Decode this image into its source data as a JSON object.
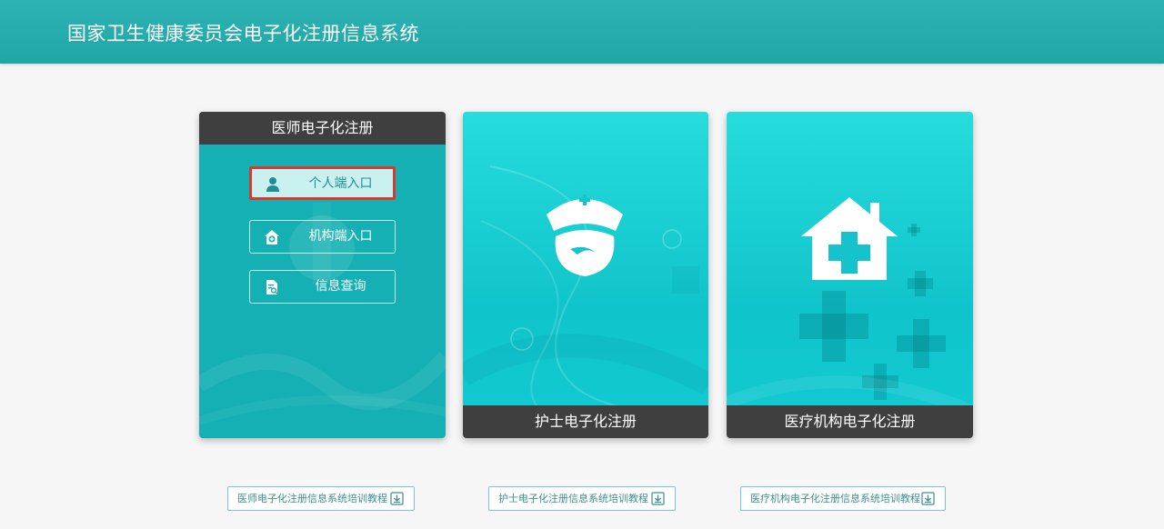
{
  "header": {
    "title": "国家卫生健康委员会电子化注册信息系统"
  },
  "cards": {
    "doctor": {
      "title": "医师电子化注册",
      "buttons": [
        {
          "label": "个人端入口",
          "icon": "person-icon",
          "selected": true
        },
        {
          "label": "机构端入口",
          "icon": "hospital-icon",
          "selected": false
        },
        {
          "label": "信息查询",
          "icon": "document-search-icon",
          "selected": false
        }
      ]
    },
    "nurse": {
      "title": "护士电子化注册",
      "icon": "nurse-cap-icon"
    },
    "institution": {
      "title": "医疗机构电子化注册",
      "icon": "hospital-house-icon"
    }
  },
  "tutorials": [
    {
      "label": "医师电子化注册信息系统培训教程",
      "icon": "download-icon"
    },
    {
      "label": "护士电子化注册信息系统培训教程",
      "icon": "download-icon"
    },
    {
      "label": "医疗机构电子化注册信息系统培训教程",
      "icon": "download-icon"
    }
  ],
  "colors": {
    "header": "#1fa6a6",
    "card_teal": "#14b0b3",
    "card_cyan": "#12cbd2",
    "dark_bar": "#3f3f3f",
    "selected_bg": "#c9f1f0",
    "highlight_border": "#d63a2e"
  }
}
